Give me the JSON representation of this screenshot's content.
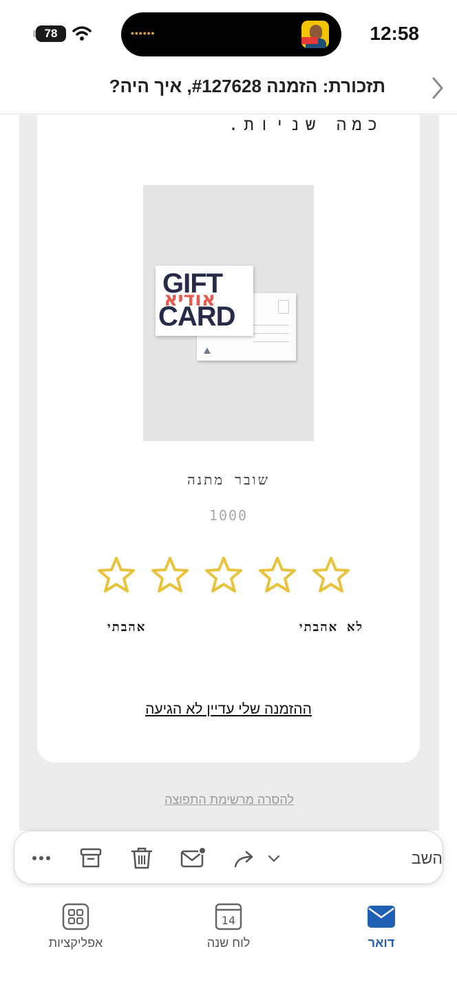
{
  "status_bar": {
    "battery": "78",
    "time": "12:58"
  },
  "header": {
    "subject": "תזכורת: הזמנה #127628, איך היה?"
  },
  "email": {
    "intro_text": "כמה שניות.",
    "product": {
      "image_text_top": "GIFT",
      "image_text_bottom": "CARD",
      "image_text_overlay": "אודיא",
      "name": "שובר מתנה",
      "price": "1000"
    },
    "rating": {
      "stars": 5,
      "star_color": "#e8c33d",
      "label_dislike": "לא אהבתי",
      "label_like": "אהבתי"
    },
    "not_arrived_link": "ההזמנה שלי עדיין לא הגיעה",
    "unsubscribe_link": "להסרה מרשימת התפוצה"
  },
  "toolbar": {
    "reply_label": "השב",
    "icons": [
      "more-icon",
      "archive-icon",
      "trash-icon",
      "mark-unread-icon",
      "forward-icon"
    ]
  },
  "bottom_nav": {
    "items": [
      {
        "label": "אפליקציות",
        "icon": "apps-icon",
        "active": false
      },
      {
        "label": "לוח שנה",
        "icon": "calendar-icon",
        "day": "14",
        "active": false
      },
      {
        "label": "דואר",
        "icon": "mail-icon",
        "active": true
      }
    ],
    "active_color": "#1f5fb4"
  }
}
